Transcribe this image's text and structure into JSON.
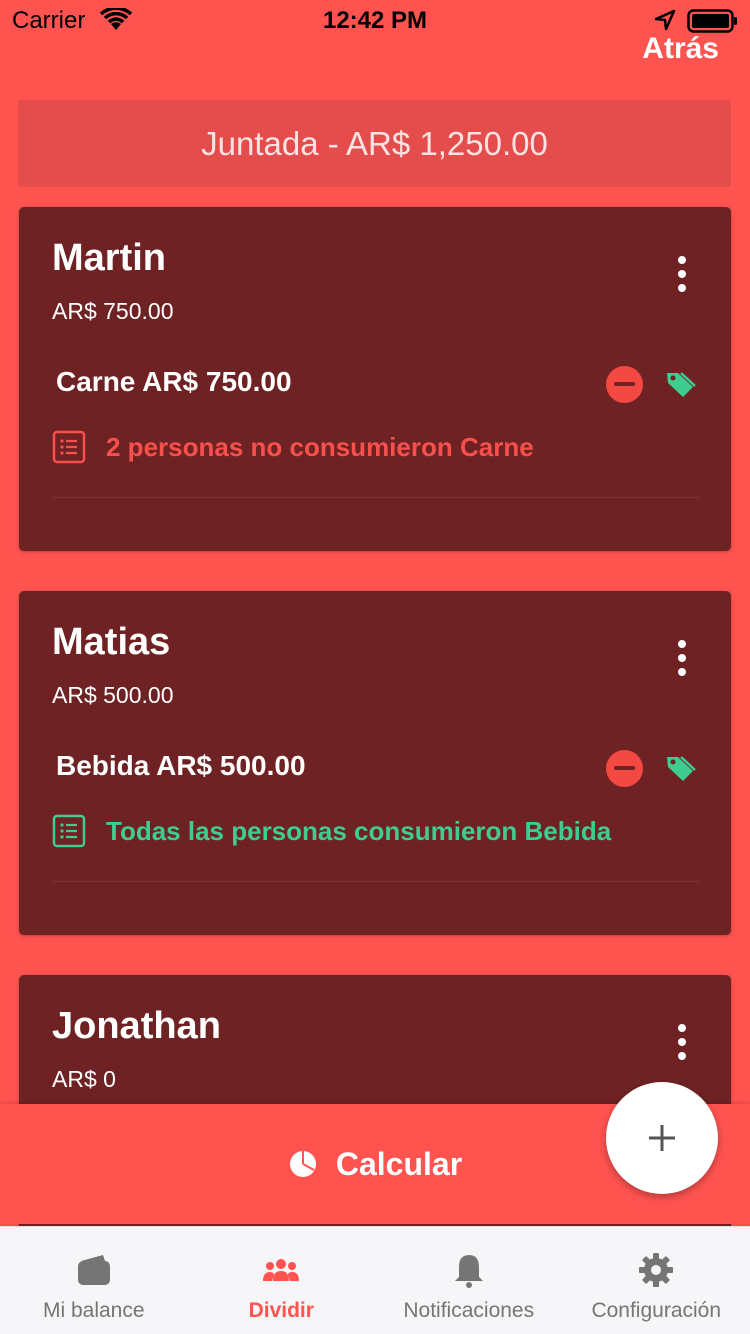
{
  "status_bar": {
    "carrier": "Carrier",
    "time": "12:42 PM"
  },
  "header": {
    "back_label": "Atrás"
  },
  "total_banner": "Juntada - AR$ 1,250.00",
  "people": [
    {
      "name": "Martin",
      "amount": "AR$ 750.00",
      "item": "Carne AR$ 750.00",
      "consume_text": "2 personas no consumieron Carne",
      "consume_status_color": "#f8504d"
    },
    {
      "name": "Matias",
      "amount": "AR$ 500.00",
      "item": "Bebida AR$ 500.00",
      "consume_text": "Todas las personas consumieron Bebida",
      "consume_status_color": "#3ecc90"
    },
    {
      "name": "Jonathan",
      "amount": "AR$ 0"
    }
  ],
  "calc_button": {
    "label": "Calcular"
  },
  "tabs": [
    {
      "label": "Mi balance",
      "icon": "wallet-icon"
    },
    {
      "label": "Dividir",
      "icon": "people-icon",
      "active": true
    },
    {
      "label": "Notificaciones",
      "icon": "bell-icon"
    },
    {
      "label": "Configuración",
      "icon": "gear-icon"
    }
  ],
  "colors": {
    "background": "#ff5350",
    "card": "#6f2223",
    "accent_green": "#3ecc90",
    "tab_inactive": "#757575"
  }
}
